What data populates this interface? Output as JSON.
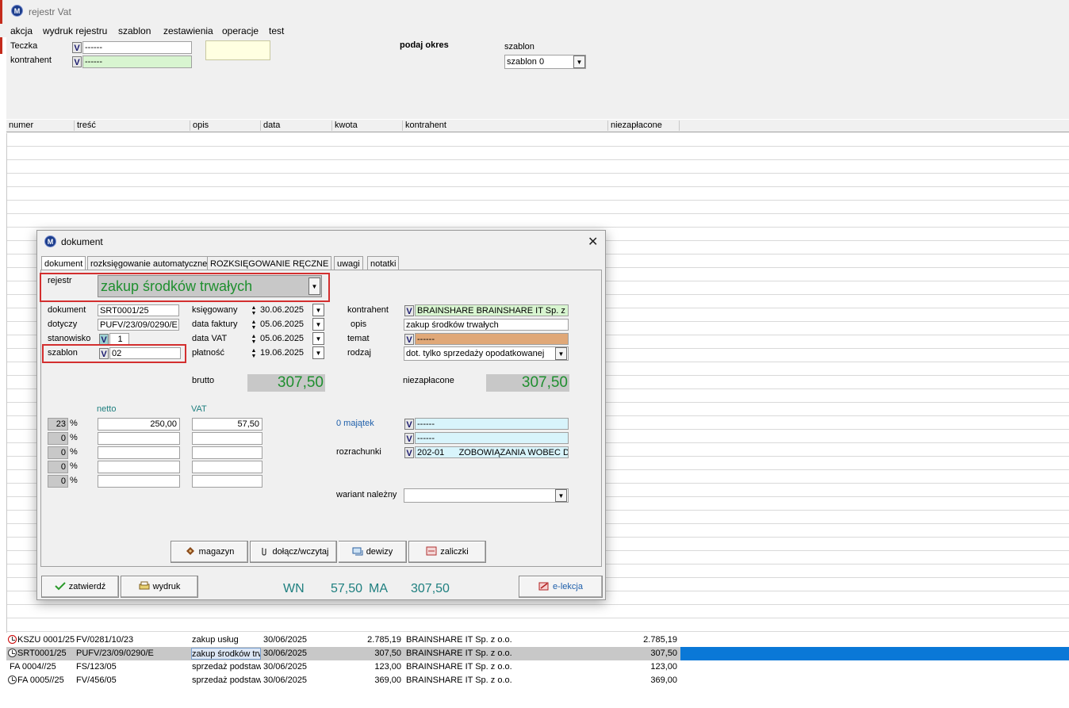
{
  "window": {
    "title": "rejestr Vat",
    "icon": "app-logo-icon"
  },
  "menu": [
    "akcja",
    "wydruk rejestru",
    "szablon",
    "zestawienia",
    "operacje",
    "test"
  ],
  "filters": {
    "teczka_label": "Teczka",
    "teczka_value": "------",
    "kontrahent_label": "kontrahent",
    "kontrahent_value": "------",
    "okres_label": "podaj okres",
    "szablon_label": "szablon",
    "szablon_value": "szablon 0"
  },
  "grid": {
    "columns": [
      "numer",
      "treść",
      "opis",
      "data",
      "kwota",
      "kontrahent",
      "niezapłacone"
    ],
    "rows": [
      {
        "numer": "KSZU 0001/25",
        "tresc": "FV/0281/10/23",
        "opis": "zakup usług",
        "data": "30/06/2025",
        "kwota": "2.785,19",
        "kontrahent": "BRAINSHARE IT Sp. z o.o.",
        "niezaplacone": "2.785,19",
        "icon": "clock-red-icon",
        "selected": false
      },
      {
        "numer": "SRT0001/25",
        "tresc": "PUFV/23/09/0290/E",
        "opis": "zakup środków trw",
        "data": "30/06/2025",
        "kwota": "307,50",
        "kontrahent": "BRAINSHARE IT Sp. z o.o.",
        "niezaplacone": "307,50",
        "icon": "clock-icon",
        "selected": true
      },
      {
        "numer": "FA 0004//25",
        "tresc": "FS/123/05",
        "opis": "sprzedaż podstaw",
        "data": "30/06/2025",
        "kwota": "123,00",
        "kontrahent": "BRAINSHARE IT Sp. z o.o.",
        "niezaplacone": "123,00",
        "icon": "",
        "selected": false
      },
      {
        "numer": "FA 0005//25",
        "tresc": "FV/456/05",
        "opis": "sprzedaż podstaw",
        "data": "30/06/2025",
        "kwota": "369,00",
        "kontrahent": "BRAINSHARE IT Sp. z o.o.",
        "niezaplacone": "369,00",
        "icon": "clock-icon",
        "selected": false
      }
    ]
  },
  "dialog": {
    "title": "dokument",
    "close": "✕",
    "tabs": [
      "dokument",
      "rozksięgowanie automatyczne",
      "ROZKSIĘGOWANIE RĘCZNE",
      "uwagi",
      "notatki"
    ],
    "rejestr_label": "rejestr",
    "rejestr_value": "zakup środków trwałych",
    "dokument_label": "dokument",
    "dokument_value": "SRT0001/25",
    "dotyczy_label": "dotyczy",
    "dotyczy_value": "PUFV/23/09/0290/E",
    "stanowisko_label": "stanowisko",
    "stanowisko_value": "1",
    "szablon_label": "szablon",
    "szablon_value": "02",
    "ksiegowany_label": "księgowany",
    "ksiegowany_value": "30.06.2025",
    "data_faktury_label": "data faktury",
    "data_faktury_value": "05.06.2025",
    "data_vat_label": "data VAT",
    "data_vat_value": "05.06.2025",
    "platnosc_label": "płatność",
    "platnosc_value": "19.06.2025",
    "kontrahent_label": "kontrahent",
    "kontrahent_value": "BRAINSHARE BRAINSHARE IT Sp. z o",
    "opis_label": "opis",
    "opis_value": "zakup środków trwałych",
    "temat_label": "temat",
    "temat_value": "------",
    "rodzaj_label": "rodzaj",
    "rodzaj_value": "dot. tylko sprzedaży opodatkowanej",
    "brutto_label": "brutto",
    "brutto_value": "307,50",
    "niezaplacone_label": "niezapłacone",
    "niezaplacone_value": "307,50",
    "netto_header": "netto",
    "vat_header": "VAT",
    "rates": [
      {
        "rate": "23",
        "netto": "250,00",
        "vat": "57,50"
      },
      {
        "rate": "0",
        "netto": "",
        "vat": ""
      },
      {
        "rate": "0",
        "netto": "",
        "vat": ""
      },
      {
        "rate": "0",
        "netto": "",
        "vat": ""
      },
      {
        "rate": "0",
        "netto": "",
        "vat": ""
      }
    ],
    "pct_sign": "%",
    "majatek_label": "0 majątek",
    "majatek_value": "------",
    "majatek2_value": "------",
    "rozrachunki_label": "rozrachunki",
    "rozrachunki_value": "202-01      ZOBOWIĄZANIA WOBEC D",
    "wariant_label": "wariant należny",
    "wariant_value": "",
    "buttons": {
      "magazyn": "magazyn",
      "dolacz": "dołącz/wczytaj",
      "dewizy": "dewizy",
      "zaliczki": "zaliczki",
      "zatwierdz": "zatwierdź",
      "wydruk": "wydruk",
      "elekcja": "e-lekcja"
    },
    "summary": {
      "wn_label": "WN",
      "wn_value": "57,50",
      "ma_label": "MA",
      "ma_value": "307,50"
    }
  },
  "colors": {
    "accent_green": "#1f8f2f",
    "selection_blue": "#0a78d7",
    "highlight_red": "#d32f2f",
    "temat_bg": "#e0a878",
    "cyan_field": "#d8f4fb",
    "lightgreen_field": "#d8f5d0"
  }
}
